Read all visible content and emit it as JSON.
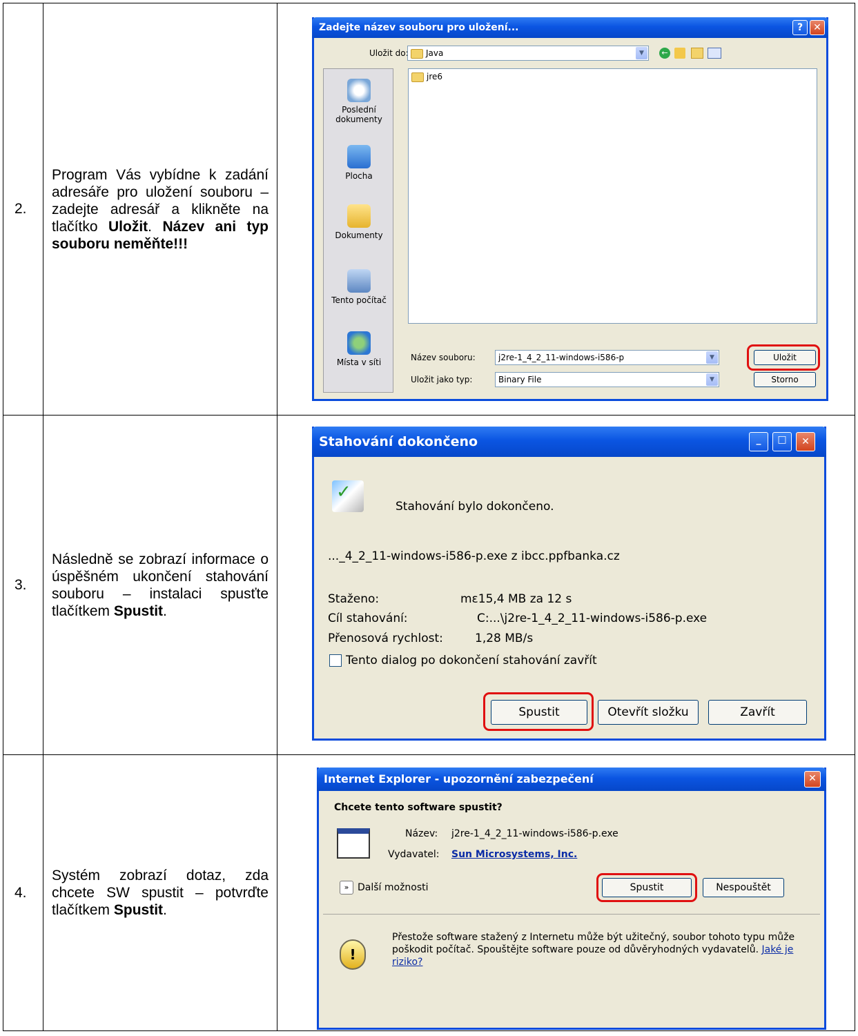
{
  "rows": [
    {
      "number": "2.",
      "text_parts": [
        "Program Vás vybídne k zadání adresáře pro uložení souboru – zadejte adresář a klikněte na tlačítko ",
        "Uložit",
        ". ",
        "Název ani typ souboru neměňte!!!"
      ]
    },
    {
      "number": "3.",
      "text_parts": [
        "Následně se zobrazí informace o úspěšném ukončení stahování souboru – instalaci spusťte tlačítkem ",
        "Spustit",
        "."
      ]
    },
    {
      "number": "4.",
      "text_parts": [
        "Systém zobrazí dotaz, zda chcete SW spustit – potvrďte tlačítkem ",
        "Spustit",
        "."
      ]
    }
  ],
  "save_dialog": {
    "title": "Zadejte název souboru pro uložení...",
    "help_label": "?",
    "close_label": "✕",
    "save_in_label": "Uložit do:",
    "save_in_value": "Java",
    "file_item": "jre6",
    "places": [
      "Poslední dokumenty",
      "Plocha",
      "Dokumenty",
      "Tento počítač",
      "Místa v síti"
    ],
    "filename_label": "Název souboru:",
    "filename_value": "j2re-1_4_2_11-windows-i586-p",
    "filetype_label": "Uložit jako typ:",
    "filetype_value": "Binary File",
    "save_button": "Uložit",
    "cancel_button": "Storno"
  },
  "download_dialog": {
    "title": "Stahování dokončeno",
    "status": "Stahování bylo dokončeno.",
    "file_source": "..._4_2_11-windows-i586-p.exe z ibcc.ppfbanka.cz",
    "downloaded_label": "Staženo:",
    "downloaded_value": "mε15,4 MB za 12 s",
    "target_label": "Cíl stahování:",
    "target_value": "C:...\\j2re-1_4_2_11-windows-i586-p.exe",
    "rate_label": "Přenosová rychlost:",
    "rate_value": "1,28 MB/s",
    "checkbox_label": "Tento dialog po dokončení stahování zavřít",
    "run_button": "Spustit",
    "open_folder_button": "Otevřít složku",
    "close_button": "Zavřít"
  },
  "security_dialog": {
    "title": "Internet Explorer - upozornění zabezpečení",
    "question": "Chcete tento software spustit?",
    "name_label": "Název:",
    "name_value": "j2re-1_4_2_11-windows-i586-p.exe",
    "publisher_label": "Vydavatel:",
    "publisher_value": "Sun Microsystems, Inc.",
    "more_options": "Další možnosti",
    "run_button": "Spustit",
    "dont_run_button": "Nespouštět",
    "warning": "Přestože software stažený z Internetu může být užitečný, soubor tohoto typu může poškodit počítač. Spouštějte software pouze od důvěryhodných vydavatelů.",
    "risk_link": "Jaké je riziko?"
  }
}
